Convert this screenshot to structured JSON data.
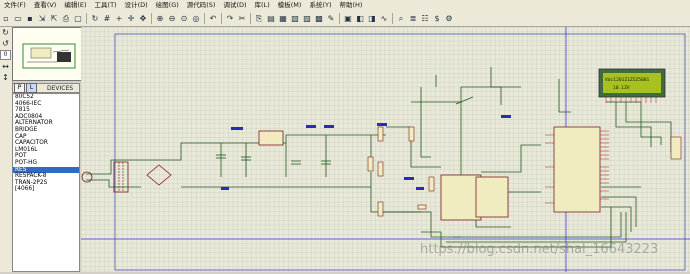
{
  "menu": [
    "文件(F)",
    "查看(V)",
    "编辑(E)",
    "工具(T)",
    "设计(D)",
    "绘图(G)",
    "源代码(S)",
    "调试(D)",
    "库(L)",
    "模板(M)",
    "系统(Y)",
    "帮助(H)"
  ],
  "toolbar_icons": [
    "new-icon",
    "open-icon",
    "save-icon",
    "import-icon",
    "export-icon",
    "print-icon",
    "area-icon",
    "refresh-icon",
    "grid-icon",
    "origin-icon",
    "crosshair-icon",
    "pan-icon",
    "zoom-in-icon",
    "zoom-out-icon",
    "zoom-all-icon",
    "zoom-area-icon",
    "undo-icon",
    "redo-icon",
    "cut-icon",
    "copy-icon",
    "paste-icon",
    "block-copy-icon",
    "block-move-icon",
    "block-rotate-icon",
    "block-delete-icon",
    "pick-device-icon",
    "make-device-icon",
    "package-icon",
    "decompose-icon",
    "wire-autoroute-icon",
    "search-icon",
    "property-icon",
    "netlist-icon",
    "bom-icon",
    "ares-icon"
  ],
  "left_tools": [
    "rotate-cw-icon",
    "rotate-ccw-icon",
    "0",
    "flip-h-icon",
    "flip-v-icon"
  ],
  "device_panel": {
    "p_btn": "P",
    "l_btn": "L",
    "label": "DEVICES"
  },
  "devices": [
    "80C52",
    "4066-IEC",
    "7815",
    "ADC0804",
    "ALTERNATOR",
    "BRIDGE",
    "CAP",
    "CAPACITOR",
    "LM016L",
    "POT",
    "POT-HG",
    "RES",
    "RESPACK-8",
    "TRAN-2P2S",
    "[4066]"
  ],
  "selected_device": "RES",
  "lcd": {
    "line1": "Vdc1201Z1Z5Z5001",
    "line2": "10.1ZV"
  },
  "watermark": "https://blog.csdn.net/shal_16643223"
}
